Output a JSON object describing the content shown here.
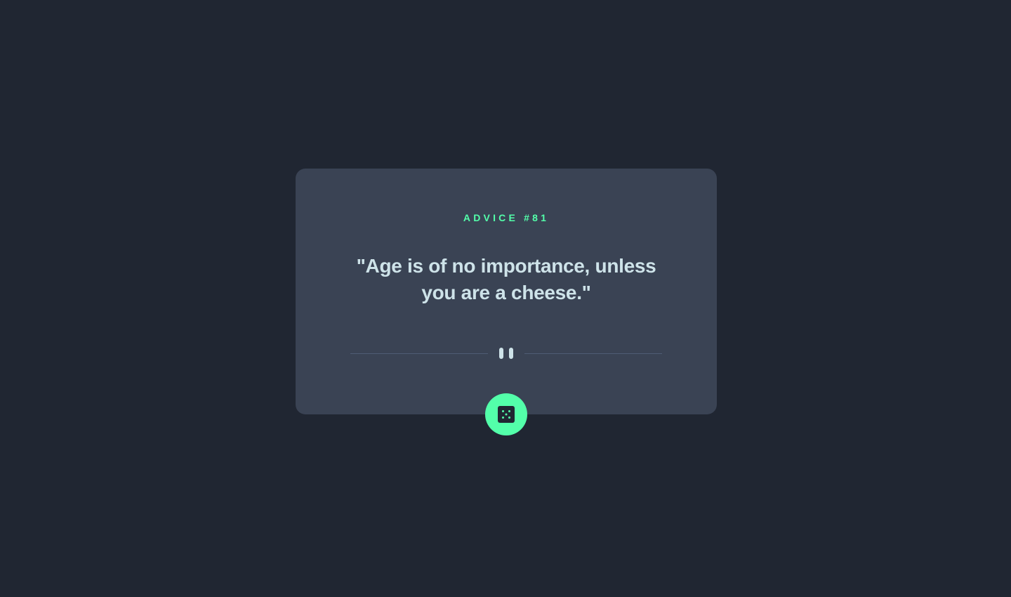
{
  "advice": {
    "label": "ADVICE #81",
    "quote": "\"Age is of no importance, unless you are a cheese.\""
  },
  "icons": {
    "divider": "pause-icon",
    "button": "dice-icon"
  },
  "colors": {
    "background": "#202632",
    "card": "#3a4354",
    "accent": "#53ffaa",
    "text": "#cee3e9",
    "divider": "#4f5d74"
  }
}
